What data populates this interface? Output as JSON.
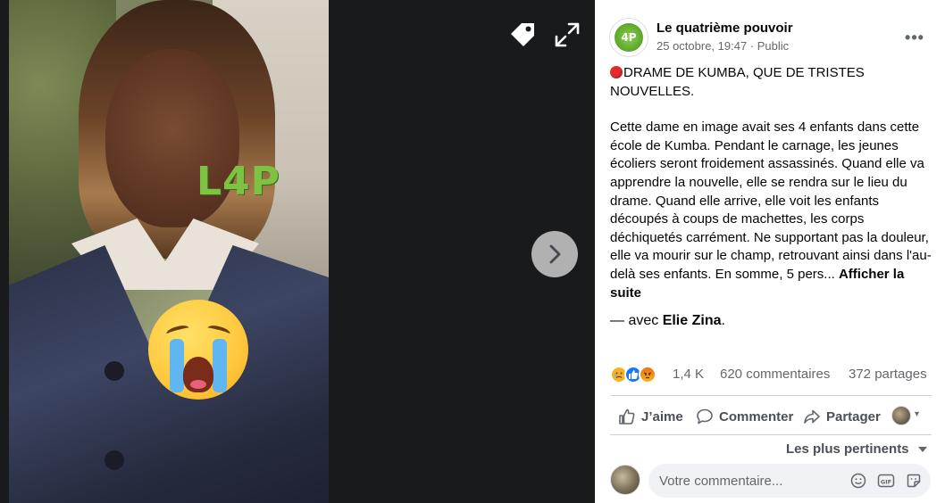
{
  "viewer": {
    "watermark_text": "L4P",
    "icons": [
      "tag-icon",
      "expand-icon",
      "chevron-right-icon",
      "crying-face-emoji"
    ]
  },
  "post": {
    "page_name": "Le quatrième pouvoir",
    "timestamp": "25 octobre, 19:47",
    "separator": " · ",
    "audience": "Public",
    "avatar_label": "4P",
    "headline": "DRAME DE KUMBA, QUE DE TRISTES NOUVELLES.",
    "body": "Cette dame en image avait ses 4 enfants dans cette école de Kumba. Pendant le carnage, les jeunes écoliers seront froidement assassinés. Quand elle va apprendre la nouvelle, elle se rendra sur le lieu du drame. Quand elle arrive, elle voit les enfants découpés à coups de machettes, les corps déchiquetés carrément. Ne supportant pas la douleur, elle va mourir sur le champ, retrouvant ainsi dans l'au-delà ses enfants. En somme, 5 pers...",
    "see_more": "Afficher la suite",
    "with_prefix": "— avec ",
    "tagged_person": "Elie Zina",
    "with_suffix": "."
  },
  "stats": {
    "reactions": "1,4 K",
    "comments": "620 commentaires",
    "shares": "372 partages",
    "reaction_types": [
      "sad",
      "like",
      "angry"
    ]
  },
  "actions": {
    "like": "J’aime",
    "comment": "Commenter",
    "share": "Partager"
  },
  "comments": {
    "sort_label": "Les plus pertinents",
    "placeholder": "Votre commentaire..."
  },
  "colors": {
    "viewer_bg": "#191a1c",
    "accent_blue": "#1877f2",
    "watermark_green": "#7dc243",
    "secondary_text": "#65676b"
  }
}
